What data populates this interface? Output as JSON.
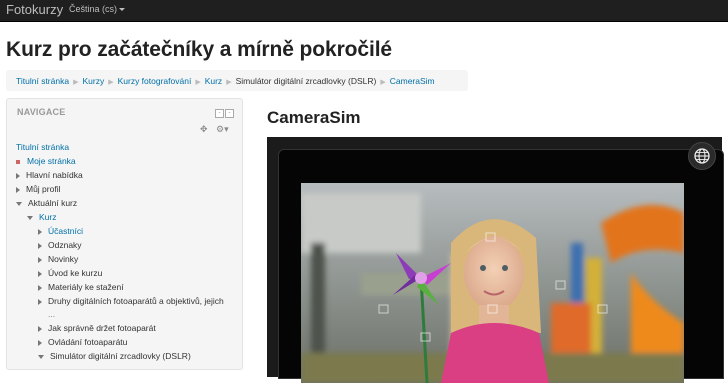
{
  "topbar": {
    "brand": "Fotokurzy",
    "language": "Čeština (cs)"
  },
  "page_title": "Kurz pro začátečníky a mírně pokročilé",
  "breadcrumb": [
    "Titulní stránka",
    "Kurzy",
    "Kurzy fotografování",
    "Kurz",
    "Simulátor digitální zrcadlovky (DSLR)",
    "CameraSim"
  ],
  "navigation": {
    "title": "NAVIGACE",
    "items": [
      "Titulní stránka",
      "Moje stránka",
      "Hlavní nabídka",
      "Můj profil",
      "Aktuální kurz",
      "Kurz",
      "Účastníci",
      "Odznaky",
      "Novinky",
      "Úvod ke kurzu",
      "Materiály ke stažení",
      "Druhy digitálních fotoaparátů a objektivů, jejich",
      "...",
      "Jak správně držet fotoaparát",
      "Ovládání fotoaparátu",
      "Simulátor digitální zrcadlovky (DSLR)"
    ]
  },
  "module_title": "CameraSim",
  "icons": {
    "globe": "globe-icon",
    "move": "move-icon",
    "settings": "gear-icon",
    "dock": "dock-icon",
    "collapse": "collapse-icon"
  },
  "colors": {
    "link": "#0070a8",
    "topbar": "#1f1f1f"
  }
}
